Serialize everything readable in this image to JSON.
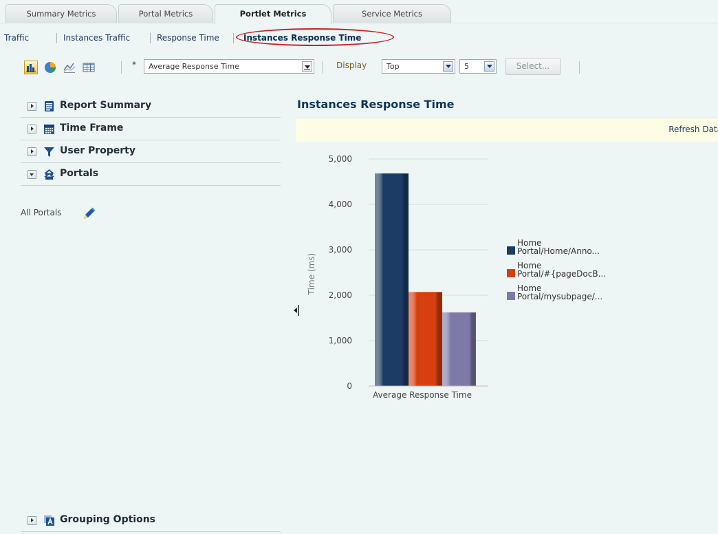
{
  "tabs": [
    {
      "label": "Summary Metrics",
      "active": false
    },
    {
      "label": "Portal Metrics",
      "active": false
    },
    {
      "label": "Portlet Metrics",
      "active": true
    },
    {
      "label": "Service Metrics",
      "active": false
    }
  ],
  "subnav": {
    "items": [
      "Traffic",
      "Instances Traffic",
      "Response Time",
      "Instances Response Time"
    ],
    "current": "Instances Response Time"
  },
  "toolbar": {
    "view_icons": [
      "bar-chart-icon",
      "pie-chart-icon",
      "line-chart-icon",
      "table-icon"
    ],
    "required_marker": "*",
    "metric_select": "Average Response Time",
    "display_label": "Display",
    "display_select": "Top",
    "count_select": "5",
    "select_button": "Select..."
  },
  "left_panel": {
    "sections": [
      {
        "title": "Report Summary",
        "icon": "report-icon",
        "expanded": false
      },
      {
        "title": "Time Frame",
        "icon": "calendar-icon",
        "expanded": false
      },
      {
        "title": "User Property",
        "icon": "filter-icon",
        "expanded": false
      },
      {
        "title": "Portals",
        "icon": "portals-icon",
        "expanded": true
      }
    ],
    "portals_value": "All Portals",
    "grouping": {
      "title": "Grouping Options",
      "icon": "grouping-icon",
      "expanded": false
    }
  },
  "report": {
    "title": "Instances Response Time",
    "refresh_link": "Refresh Data"
  },
  "colors": {
    "accent": "#0f3559",
    "highlight_oval": "#cc1f26",
    "series": [
      "#1c3c66",
      "#d63f10",
      "#7e7aa8"
    ]
  },
  "chart_data": {
    "type": "bar",
    "categories": [
      "Average Response Time"
    ],
    "series": [
      {
        "name": "Home Portal/Home/Anno...",
        "values": [
          4680
        ]
      },
      {
        "name": "Home Portal/#{pageDocB...",
        "values": [
          2070
        ]
      },
      {
        "name": "Home Portal/mysubpage/...",
        "values": [
          1620
        ]
      }
    ],
    "xlabel": "",
    "ylabel": "Time (ms)",
    "ylim": [
      0,
      5000
    ],
    "yticks": [
      "0",
      "1,000",
      "2,000",
      "3,000",
      "4,000",
      "5,000"
    ],
    "grid": true,
    "legend_position": "right"
  }
}
